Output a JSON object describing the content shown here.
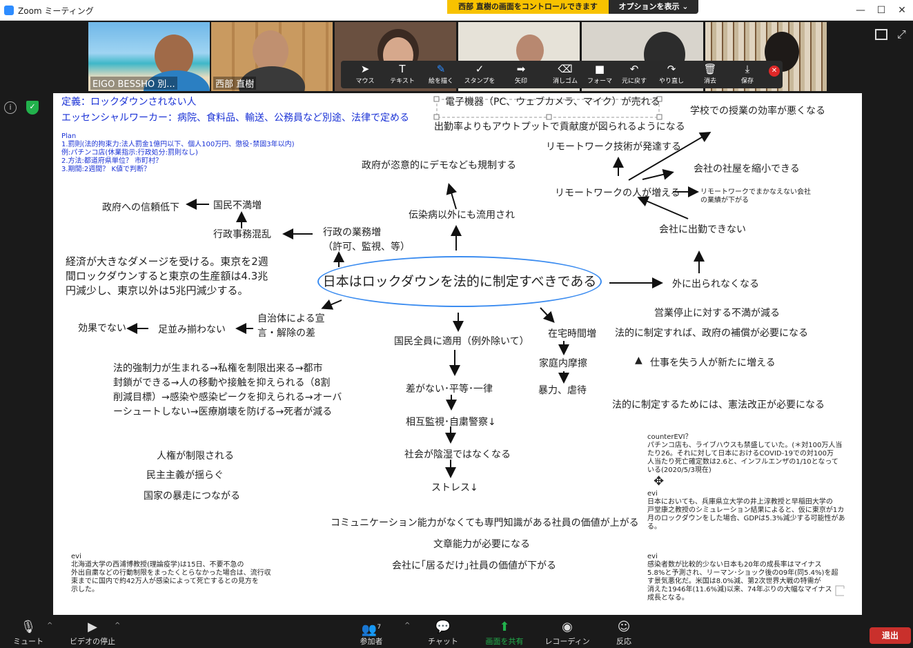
{
  "window": {
    "title": "Zoom ミーティング",
    "minimize": "—",
    "maximize": "☐",
    "close": "✕"
  },
  "banner": {
    "control": "西部 直樹の画面をコントロールできます",
    "options": "オプションを表示 ⌄"
  },
  "participants": [
    {
      "name": "EIGO BESSHO 別..."
    },
    {
      "name": "西部 直樹"
    },
    {
      "name": ""
    },
    {
      "name": ""
    },
    {
      "name": ""
    },
    {
      "name": ""
    }
  ],
  "annotate": {
    "tools": [
      {
        "icon": "mouse-icon",
        "glyph": "➤",
        "label": "マウス"
      },
      {
        "icon": "text-icon",
        "glyph": "T",
        "label": "テキスト"
      },
      {
        "icon": "draw-icon",
        "glyph": "✎",
        "label": "絵を描く"
      },
      {
        "icon": "stamp-icon",
        "glyph": "✓",
        "label": "スタンプを"
      },
      {
        "icon": "arrow-icon",
        "glyph": "➡",
        "label": "矢印"
      },
      {
        "icon": "eraser-icon",
        "glyph": "⌫",
        "label": "消しゴム"
      },
      {
        "icon": "format-icon",
        "glyph": "■",
        "label": "フォーマ"
      },
      {
        "icon": "undo-icon",
        "glyph": "↶",
        "label": "元に戻す"
      },
      {
        "icon": "redo-icon",
        "glyph": "↷",
        "label": "やり直し"
      },
      {
        "icon": "trash-icon",
        "glyph": "🗑",
        "label": "消去"
      },
      {
        "icon": "save-icon",
        "glyph": "⤓",
        "label": "保存"
      }
    ],
    "close_glyph": "✕",
    "active_color": "#2d8cff"
  },
  "side": {
    "info_glyph": "i",
    "shield_glyph": "✓",
    "shield_color": "#22b14c"
  },
  "board": {
    "definition": "定義：ロックダウンされない人",
    "essential": "エッセンシャルワーカー：病院、食料品、輸送、公務員など別途、法律で定める",
    "plan": "Plan\n1.罰則(法的拘束力:法人罰金1億円以下、個人100万円、懲役･禁固3年以内)\n        例:パチンコ店(休業指示:行政処分:罰則なし)\n2.方法:都道府県単位？ 市町村？\n3.期間:2週間？ K値で判断？",
    "center": "日本はロックダウンを法的に制定すべきである",
    "electronics": "電子機器（PC、ウェブカメラ、マイク）が売れる",
    "output": "出勤率よりもアウトプットで貢献度が図られるようになる",
    "school": "学校での授業の効率が悪くなる",
    "remote_tech": "リモートワーク技術が発達する",
    "office_shrink": "会社の社屋を縮小できる",
    "remote_increase": "リモートワークの人が増える",
    "remote_fail": "リモートワークでまかなえない会社\nの業績が下がる",
    "no_commute": "会社に出勤できない",
    "cant_go_out": "外に出られなくなる",
    "abuse_govt": "政府が恣意的にデモなども規制する",
    "diverted": "伝染病以外にも流用され",
    "trust_down": "政府への信頼低下",
    "discontent": "国民不満増",
    "admin_chaos": "行政事務混乱",
    "admin_work": "行政の業務増\n（許可、監視、等）",
    "economy": "経済が大きなダメージを受ける。東京を2週\n間ロックダウンすると東京の生産額は4.3兆\n円減少し、東京以外は5兆円減少する。",
    "local_gov": "自治体による宣\n言・解除の差",
    "not_aligned": "足並み揃わない",
    "ineffective": "効果でない",
    "all_citizens": "国民全員に適用（例外除いて）",
    "home_time": "在宅時間増",
    "family_friction": "家庭内摩擦",
    "violence": "暴力、虐待",
    "business_stop": "営業停止に対する不満が減る",
    "compensation": "法的に制定すれば、政府の補償が必要になる",
    "job_loss": "仕事を失う人が新たに増える",
    "constitution": "法的に制定するためには、憲法改正が必要になる",
    "legal_force": "法的強制力が生まれる→私権を制限出来る→都市\n封鎖ができる→人の移動や接触を抑えられる（8割\n削減目標）→感染や感染ピークを抑えられる→オーバ\nーシュートしない→医療崩壊を防げる→死者が減る",
    "no_diff": "差がない･平等･一律",
    "mutual": "相互監視･自粛警察↓",
    "not_gloomy": "社会が陰湿ではなくなる",
    "stress": "ストレス↓",
    "rights": "人権が制限される",
    "democracy": "民主主義が揺らぐ",
    "state_runaway": "国家の暴走につながる",
    "comm_skill": "コミュニケーション能力がなくても専門知識がある社員の価値が上がる",
    "writing": "文章能力が必要になる",
    "just_there": "会社に｢居るだけ｣社員の価値が下がる",
    "counter_evi": "counterEVI？\nパチンコ店も、ライブハウスも禁盛していた。(＊対100万人当\nたり26。それに対して日本におけるCOVID-19での対100万\n人当たり死亡確定数は2.6と、インフルエンザの1/10となって\nいる(2020/5/3現在)",
    "evi_right1": "evi\n日本においても、兵庫県立大学の井上淳教授と早稲田大学の\n戸堂康之教授のシミュレーション結果によると、仮に東京が1カ\n月のロックダウンをした場合、GDPは5.3%減少する可能性があ\nる。",
    "evi_right2": "evi\n感染者数が比較的少ない日本も20年の成長率はマイナス\n5.8%と予測され、リーマン･ショック後の09年(同5.4%)を超\nす景気悪化だ。米国は8.0%減、第2次世界大戦の特需が\n消えた1946年(11.6%減)以来、74年ぶりの大幅なマイナス\n成長となる。",
    "evi_left": "evi\n北海道大学の西浦博教授(理論疫学)は15日、不要不急の\n外出自粛などの行動制限をまったくとらなかった場合は、流行収\n束までに国内で約42万人が感染によって死亡するとの見方を\n示した。",
    "move_glyph": "✥",
    "caret_glyph": "▲"
  },
  "bottombar": {
    "mute": "ミュート",
    "video": "ビデオの停止",
    "participants": "参加者",
    "participant_count": "7",
    "chat": "チャット",
    "share": "画面を共有",
    "record": "レコーディング",
    "react": "反応",
    "leave": "退出",
    "caret": "^"
  }
}
